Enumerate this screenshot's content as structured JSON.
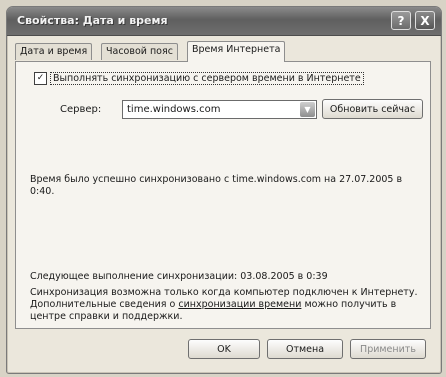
{
  "window": {
    "title": "Свойства: Дата и время"
  },
  "titlebar": {
    "help_label": "?",
    "close_label": "X"
  },
  "tabs": [
    {
      "label": "Дата и время"
    },
    {
      "label": "Часовой пояс"
    },
    {
      "label": "Время Интернета"
    }
  ],
  "sync": {
    "checkbox_checked": true,
    "checkbox_mark": "✓",
    "checkbox_label": "Выполнять синхронизацию с сервером времени в Интернете",
    "server_label": "Сервер:",
    "server_value": "time.windows.com",
    "update_button": "Обновить сейчас"
  },
  "status": {
    "text": "Время было успешно синхронизовано с time.windows.com на 27.07.2005 в 0:40."
  },
  "next": {
    "text": "Следующее выполнение синхронизации: 03.08.2005 в 0:39"
  },
  "note": {
    "before": "Синхронизация возможна только когда компьютер подключен к Интернету. Дополнительные сведения о ",
    "link": "синхронизации времени",
    "after": " можно получить в центре справки и поддержки."
  },
  "footer": {
    "ok_label": "OK",
    "cancel_label": "Отмена",
    "apply_label": "Применить"
  }
}
